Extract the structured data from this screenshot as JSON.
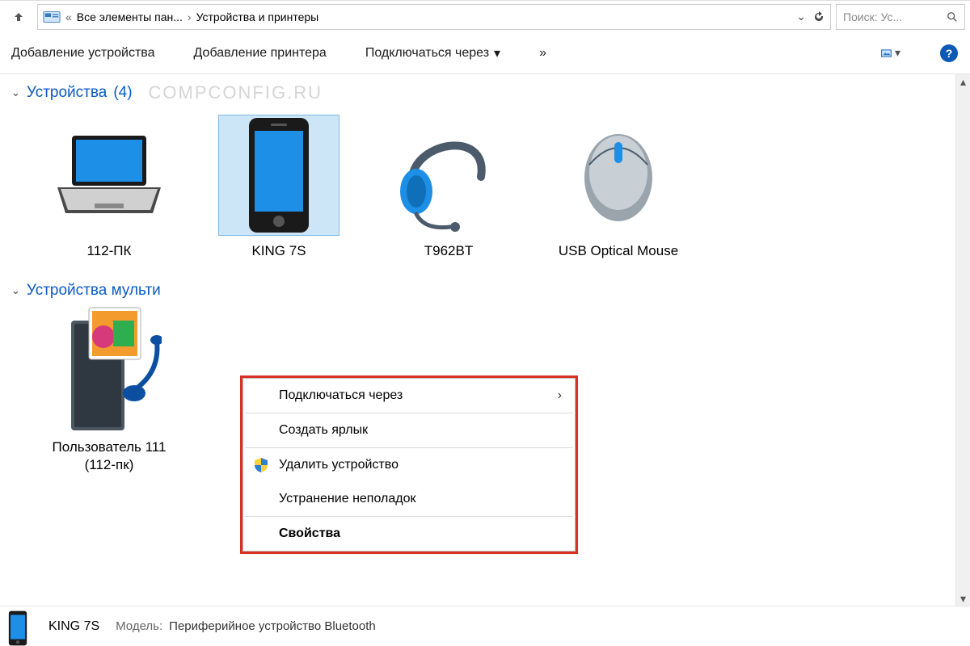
{
  "breadcrumb": {
    "parent": "Все элементы пан...",
    "current": "Устройства и принтеры"
  },
  "search": {
    "placeholder": "Поиск: Ус..."
  },
  "toolbar": {
    "add_device": "Добавление устройства",
    "add_printer": "Добавление принтера",
    "connect_via": "Подключаться через",
    "overflow": "»"
  },
  "groups": [
    {
      "title": "Устройства",
      "count": "(4)",
      "watermark": "COMPCONFIG.RU",
      "devices": [
        {
          "label": "112-ПК",
          "icon": "laptop",
          "selected": false
        },
        {
          "label": "KING 7S",
          "icon": "phone",
          "selected": true
        },
        {
          "label": "T962BT",
          "icon": "headset",
          "selected": false
        },
        {
          "label": "USB Optical Mouse",
          "icon": "mouse",
          "selected": false
        }
      ]
    },
    {
      "title": "Устройства мульти",
      "count": "",
      "devices": [
        {
          "label": "Пользователь 111 (112-пк)",
          "icon": "mediaserver",
          "selected": false
        }
      ]
    }
  ],
  "context_menu": {
    "items": [
      {
        "label": "Подключаться через",
        "submenu": true
      },
      {
        "sep": true
      },
      {
        "label": "Создать ярлык"
      },
      {
        "sep": true
      },
      {
        "label": "Удалить устройство",
        "shield": true
      },
      {
        "label": "Устранение неполадок"
      },
      {
        "sep": true
      },
      {
        "label": "Свойства",
        "bold": true
      }
    ]
  },
  "details": {
    "name": "KING 7S",
    "model_label": "Модель:",
    "model_value": "Периферийное устройство Bluetooth"
  }
}
